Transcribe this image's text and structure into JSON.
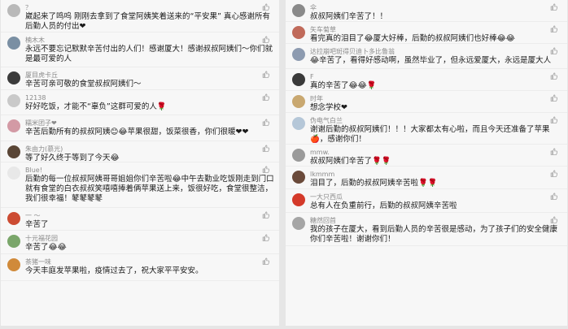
{
  "left": [
    {
      "name": "？",
      "text": "崴起来了鸣呜 刚刚去拿到了食堂阿姨笑着送来的“平安果” 真心感谢所有后勤人员的付出❤",
      "likes": "",
      "avatar": "#b9b9b9"
    },
    {
      "name": "楠木木",
      "text": "永远不要忘记默默辛苦付出的人们！感谢厦大！感谢叔叔阿姨们～你们就是最可爱的人",
      "likes": "",
      "avatar": "#7a8fa3"
    },
    {
      "name": "厦目虎卡丘",
      "text": "辛苦可亲可敬的食堂叔叔阿姨们～",
      "likes": "",
      "avatar": "#3b3b3b"
    },
    {
      "name": "12138",
      "text": "好好吃饭，才能不“辜负”这群可爱的人🌹",
      "likes": "",
      "avatar": "#c9c9c9"
    },
    {
      "name": "糯米团子❤",
      "text": "辛苦后勤所有的叔叔阿姨😊😂苹果很甜，饭菜很香，你们很暖❤❤",
      "likes": "",
      "avatar": "#d39aa5"
    },
    {
      "name": "朱由力(慕光)",
      "text": "等了好久终于等到了今天😂",
      "likes": "",
      "avatar": "#5a4636"
    },
    {
      "name": "Blue!",
      "text": "后勤的每一位叔叔阿姨哥哥姐姐你们辛苦啦😂中午去勤业吃饭刚走到门口就有食堂的白衣叔叔笑嘻嘻捧着俩苹果送上来，饭很好吃，食堂很整洁，我们很幸福！鼕鼕鼕鼕",
      "likes": "",
      "avatar": "#e8e8e8"
    },
    {
      "name": "一 ～",
      "text": "辛苦了",
      "likes": "",
      "avatar": "#cc4b32"
    },
    {
      "name": "十元福花园",
      "text": "辛苦了😂😂",
      "likes": "",
      "avatar": "#7aa66a"
    },
    {
      "name": "茶猪一味",
      "text": "今天丰庭发苹果啦，疫情过去了，祝大家平平安安。",
      "likes": "",
      "avatar": "#d08a3a"
    }
  ],
  "right": [
    {
      "name": "伞",
      "text": "叔叔阿姨们辛苦了！！",
      "likes": "",
      "avatar": "#8a8a8a"
    },
    {
      "name": "矢车菊草",
      "text": "看完真的泪目了😂厦大好棒，后勤的叔叔阿姨们也好棒😂😂",
      "likes": "",
      "avatar": "#c06a5a"
    },
    {
      "name": "达拉崩吧斑得贝迪卜多比鲁翁",
      "text": "😂辛苦了，看得好感动啊，虽然毕业了，但永远爱厦大，永远是厦大人",
      "likes": "",
      "avatar": "#8d9bb0"
    },
    {
      "name": "F",
      "text": "真的辛苦了😂😂🌹",
      "likes": "",
      "avatar": "#3a3a3a"
    },
    {
      "name": "时年",
      "text": "想念学校❤",
      "likes": "",
      "avatar": "#c9a870"
    },
    {
      "name": "伪电气白兰",
      "text": "谢谢后勤的叔叔阿姨们！！！大家都太有心啦，而且今天还准备了苹果🍎，感谢你们！",
      "likes": "",
      "avatar": "#b5c7d8"
    },
    {
      "name": "mmw.",
      "text": "叔叔阿姨们辛苦了🌹🌹",
      "likes": "",
      "avatar": "#9a9a9a"
    },
    {
      "name": "lkmmm",
      "text": "泪目了，后勤的叔叔阿姨辛苦啦🌹🌹",
      "likes": "",
      "avatar": "#6a4a3a"
    },
    {
      "name": "一大只西瓜",
      "text": "总有人在负重前行，后勤的叔叔阿姨辛苦啦",
      "likes": "",
      "avatar": "#d43a2a"
    },
    {
      "name": "糖然回首",
      "text": "我的孩子在厦大，看到后勤人员的辛苦很是感动，为了孩子们的安全健康你们辛苦啦！谢谢你们！",
      "likes": "",
      "avatar": "#a5a5a5"
    }
  ]
}
